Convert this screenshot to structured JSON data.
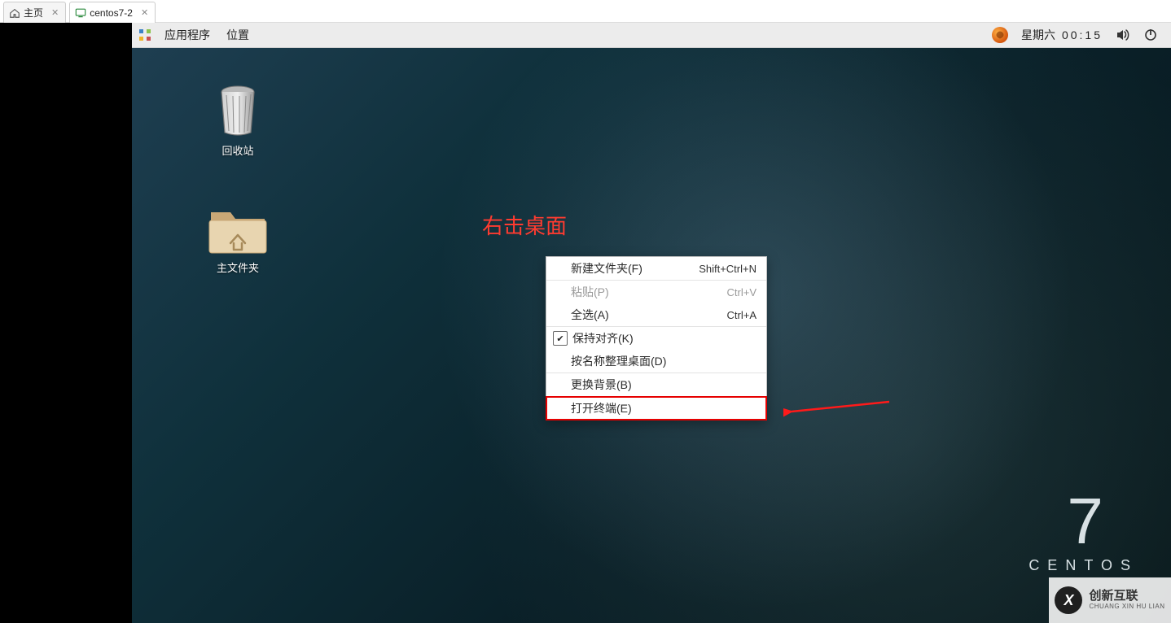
{
  "host_tabs": {
    "tab0": {
      "label": "主页"
    },
    "tab1": {
      "label": "centos7-2"
    }
  },
  "panel": {
    "applications": "应用程序",
    "places": "位置",
    "day": "星期六",
    "time": "00:15"
  },
  "desktop": {
    "trash_label": "回收站",
    "home_label": "主文件夹"
  },
  "annotation": {
    "text": "右击桌面"
  },
  "context_menu": {
    "items": {
      "new_folder": {
        "label": "新建文件夹(F)",
        "shortcut": "Shift+Ctrl+N"
      },
      "paste": {
        "label": "粘贴(P)",
        "shortcut": "Ctrl+V"
      },
      "select_all": {
        "label": "全选(A)",
        "shortcut": "Ctrl+A"
      },
      "keep_align": {
        "label": "保持对齐(K)",
        "shortcut": ""
      },
      "arrange": {
        "label": "按名称整理桌面(D)",
        "shortcut": ""
      },
      "change_bg": {
        "label": "更换背景(B)",
        "shortcut": ""
      },
      "open_term": {
        "label": "打开终端(E)",
        "shortcut": ""
      }
    }
  },
  "centos": {
    "seven": "7",
    "word": "CENTOS"
  },
  "watermark": {
    "cn": "创新互联",
    "en": "CHUANG XIN HU LIAN"
  }
}
